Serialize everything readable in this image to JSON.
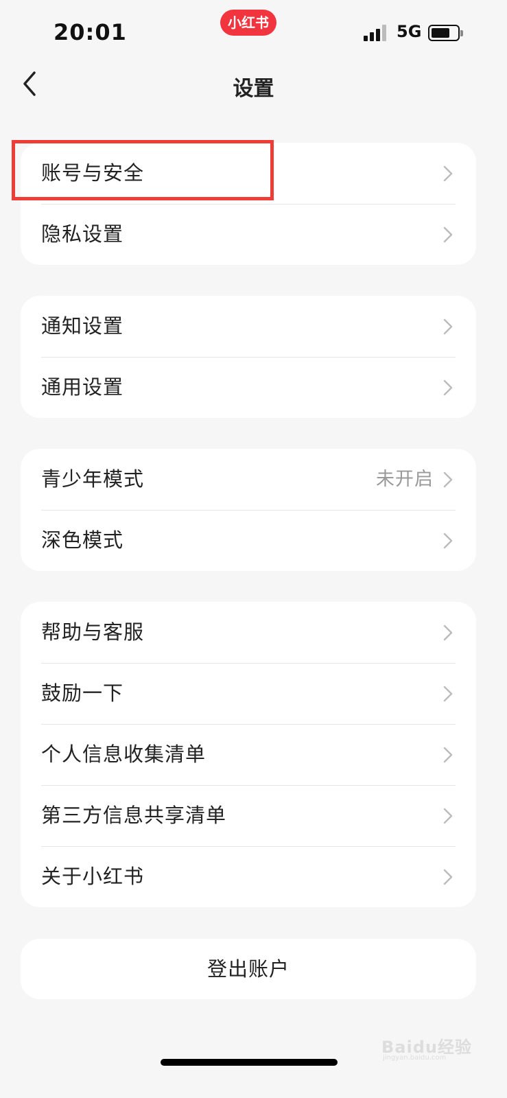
{
  "status_bar": {
    "time": "20:01",
    "app_badge": "小红书",
    "network": "5G"
  },
  "header": {
    "title": "设置"
  },
  "sections": [
    {
      "items": [
        {
          "label": "账号与安全"
        },
        {
          "label": "隐私设置"
        }
      ]
    },
    {
      "items": [
        {
          "label": "通知设置"
        },
        {
          "label": "通用设置"
        }
      ]
    },
    {
      "items": [
        {
          "label": "青少年模式",
          "value": "未开启"
        },
        {
          "label": "深色模式"
        }
      ]
    },
    {
      "items": [
        {
          "label": "帮助与客服"
        },
        {
          "label": "鼓励一下"
        },
        {
          "label": "个人信息收集清单"
        },
        {
          "label": "第三方信息共享清单"
        },
        {
          "label": "关于小红书"
        }
      ]
    }
  ],
  "logout": {
    "label": "登出账户"
  },
  "watermark": {
    "logo": "Baidu经验",
    "url": "jingyan.baidu.com"
  },
  "colors": {
    "background": "#f6f6f6",
    "card": "#ffffff",
    "badge": "#f1343e",
    "highlight": "#ee3c36",
    "secondary_text": "#999999"
  }
}
